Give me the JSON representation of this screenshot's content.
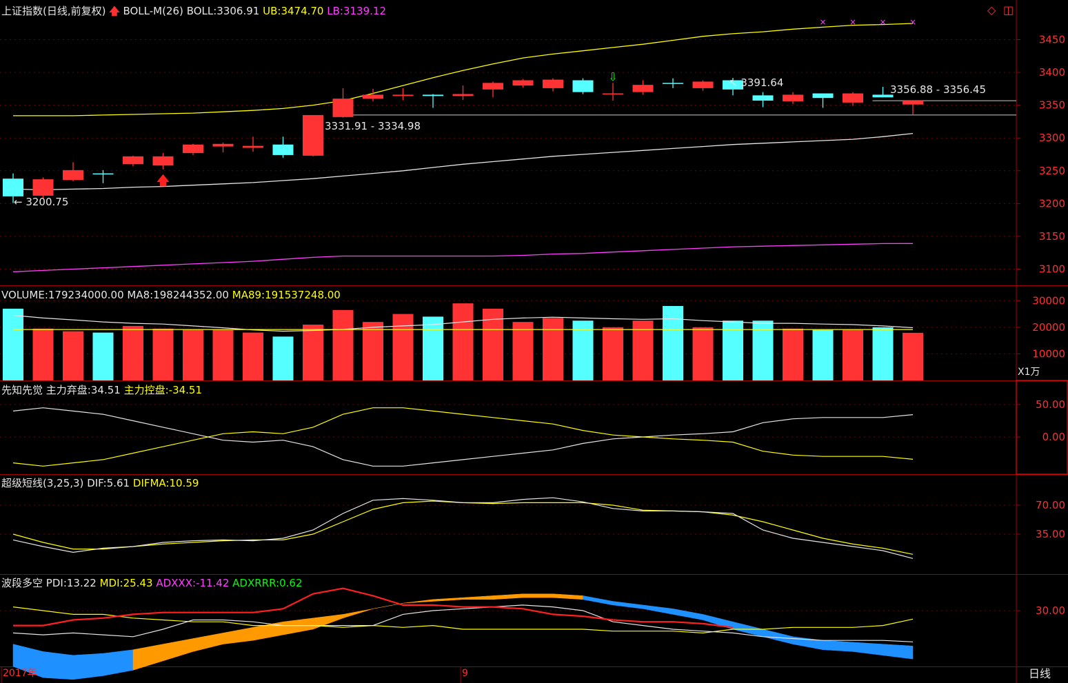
{
  "header": {
    "title": "上证指数(日线,前复权)",
    "boll_name": "BOLL-M(26)",
    "boll_label": "BOLL:",
    "boll_value": "3306.91",
    "ub_label": "UB:",
    "ub_value": "3474.70",
    "lb_label": "LB:",
    "lb_value": "3139.12"
  },
  "volume_header": {
    "name": "VOLUME:",
    "value": "179234000.00",
    "ma8_label": "MA8:",
    "ma8_value": "198244352.00",
    "ma89_label": "MA89:",
    "ma89_value": "191537248.00",
    "unit": "X1万"
  },
  "xzxj_header": {
    "name": "先知先觉",
    "a_label": "主力弃盘:",
    "a_value": "34.51",
    "b_label": "主力控盘:",
    "b_value": "-34.51"
  },
  "cjdx_header": {
    "name": "超级短线(3,25,3)",
    "dif_label": "DIF:",
    "dif_value": "5.61",
    "difma_label": "DIFMA:",
    "difma_value": "10.59"
  },
  "bddk_header": {
    "name": "波段多空",
    "pdi_label": "PDI:",
    "pdi_value": "13.22",
    "mdi_label": "MDI:",
    "mdi_value": "25.43",
    "adxxx_label": "ADXXX:",
    "adxxx_value": "-11.42",
    "adxrrr_label": "ADXRRR:",
    "adxrrr_value": "0.62"
  },
  "annotations": {
    "low_label": "3200.75",
    "high_label": "3391.64",
    "gap_low": "3331.91 - 3334.98",
    "gap_high": "3356.88 - 3356.45"
  },
  "time_axis": {
    "start": "2017年",
    "mid": "9",
    "period": "日线"
  },
  "colors": {
    "up": "#ff3333",
    "down": "#55ffff",
    "boll": "#e6e6e6",
    "ub": "#ffff00",
    "lb": "#ff40ff",
    "orange": "#ff9900",
    "blue": "#1e90ff"
  },
  "chart_data": {
    "type": "candlestick",
    "price_axis": {
      "ticks": [
        3100,
        3150,
        3200,
        3250,
        3300,
        3350,
        3400,
        3450
      ]
    },
    "candles": [
      {
        "o": 3211,
        "h": 3246,
        "l": 3200.75,
        "c": 3238,
        "up": false
      },
      {
        "o": 3212,
        "h": 3240,
        "l": 3208,
        "c": 3237,
        "up": true
      },
      {
        "o": 3236,
        "h": 3263,
        "l": 3234,
        "c": 3251,
        "up": true
      },
      {
        "o": 3246,
        "h": 3251,
        "l": 3231,
        "c": 3245,
        "up": false
      },
      {
        "o": 3260,
        "h": 3273,
        "l": 3257,
        "c": 3272,
        "up": true
      },
      {
        "o": 3258,
        "h": 3277,
        "l": 3252,
        "c": 3272,
        "up": true
      },
      {
        "o": 3277,
        "h": 3291,
        "l": 3274,
        "c": 3290,
        "up": true
      },
      {
        "o": 3287,
        "h": 3293,
        "l": 3278,
        "c": 3291,
        "up": true
      },
      {
        "o": 3285,
        "h": 3302,
        "l": 3279,
        "c": 3288,
        "up": true
      },
      {
        "o": 3290,
        "h": 3302,
        "l": 3270,
        "c": 3274,
        "up": false
      },
      {
        "o": 3273,
        "h": 3331,
        "l": 3272,
        "c": 3334.98,
        "up": true
      },
      {
        "o": 3331.91,
        "h": 3376,
        "l": 3331,
        "c": 3360,
        "up": true
      },
      {
        "o": 3360,
        "h": 3375,
        "l": 3356,
        "c": 3366,
        "up": true
      },
      {
        "o": 3364,
        "h": 3376,
        "l": 3358,
        "c": 3366,
        "up": true
      },
      {
        "o": 3366,
        "h": 3367,
        "l": 3346,
        "c": 3364,
        "up": false
      },
      {
        "o": 3364,
        "h": 3380,
        "l": 3358,
        "c": 3367,
        "up": true
      },
      {
        "o": 3374,
        "h": 3386,
        "l": 3362,
        "c": 3384,
        "up": true
      },
      {
        "o": 3380,
        "h": 3390,
        "l": 3377,
        "c": 3388,
        "up": true
      },
      {
        "o": 3376,
        "h": 3391,
        "l": 3371,
        "c": 3389,
        "up": true
      },
      {
        "o": 3388,
        "h": 3391,
        "l": 3367,
        "c": 3370,
        "up": false
      },
      {
        "o": 3368,
        "h": 3384,
        "l": 3357,
        "c": 3367,
        "up": true
      },
      {
        "o": 3370,
        "h": 3388,
        "l": 3366,
        "c": 3381,
        "up": true
      },
      {
        "o": 3384,
        "h": 3391,
        "l": 3376,
        "c": 3384,
        "up": false
      },
      {
        "o": 3376,
        "h": 3388,
        "l": 3372,
        "c": 3386,
        "up": true
      },
      {
        "o": 3374,
        "h": 3391.64,
        "l": 3365,
        "c": 3388,
        "up": false
      },
      {
        "o": 3365,
        "h": 3370,
        "l": 3347,
        "c": 3357,
        "up": false
      },
      {
        "o": 3356,
        "h": 3370,
        "l": 3352,
        "c": 3366,
        "up": true
      },
      {
        "o": 3361,
        "h": 3368,
        "l": 3346,
        "c": 3368,
        "up": false
      },
      {
        "o": 3354,
        "h": 3370,
        "l": 3349,
        "c": 3368,
        "up": true
      },
      {
        "o": 3362,
        "h": 3378,
        "l": 3362,
        "c": 3366,
        "up": false
      },
      {
        "o": 3351,
        "h": 3356,
        "l": 3336,
        "c": 3356.88,
        "up": true
      }
    ],
    "boll": [
      3222,
      3221,
      3222,
      3223,
      3225,
      3226,
      3228,
      3230,
      3232,
      3235,
      3238,
      3242,
      3246,
      3250,
      3255,
      3260,
      3264,
      3268,
      3272,
      3275,
      3278,
      3281,
      3284,
      3287,
      3290,
      3292,
      3294,
      3296,
      3298,
      3302,
      3306.91
    ],
    "ub": [
      3334,
      3334,
      3334,
      3335,
      3336,
      3337,
      3338,
      3340,
      3342,
      3345,
      3350,
      3357,
      3368,
      3380,
      3392,
      3403,
      3413,
      3422,
      3428,
      3433,
      3438,
      3443,
      3449,
      3455,
      3459,
      3462,
      3466,
      3469,
      3472,
      3473,
      3474.7
    ],
    "lb": [
      3096,
      3098,
      3100,
      3102,
      3104,
      3106,
      3108,
      3110,
      3112,
      3115,
      3118,
      3120,
      3120,
      3120,
      3120,
      3120,
      3120,
      3121,
      3123,
      3124,
      3126,
      3128,
      3130,
      3132,
      3134,
      3135,
      3136,
      3137,
      3138,
      3139,
      3139.12
    ],
    "volume": [
      27000,
      19500,
      18500,
      18000,
      20500,
      19500,
      19000,
      19000,
      18000,
      16500,
      21000,
      26500,
      22000,
      25000,
      24000,
      29000,
      27000,
      22000,
      23500,
      22500,
      20000,
      22500,
      28000,
      20000,
      22500,
      22500,
      19500,
      19000,
      19000,
      20000,
      17923
    ],
    "vol_ma8": [
      24500,
      23500,
      22800,
      22000,
      21500,
      21200,
      20500,
      19800,
      19000,
      18500,
      18800,
      19200,
      20000,
      20500,
      21000,
      22000,
      23000,
      23500,
      23800,
      23500,
      23200,
      23000,
      23200,
      22500,
      22000,
      21500,
      21500,
      21200,
      21000,
      20500,
      19824
    ],
    "vol_ma89": 19154,
    "xzxj": {
      "qipan": [
        40,
        45,
        40,
        35,
        25,
        15,
        5,
        -5,
        -8,
        -5,
        -15,
        -35,
        -45,
        -45,
        -40,
        -35,
        -30,
        -25,
        -20,
        -10,
        -3,
        0,
        3,
        5,
        8,
        22,
        28,
        30,
        30,
        30,
        34.51
      ],
      "kongpan": [
        -40,
        -45,
        -40,
        -35,
        -25,
        -15,
        -5,
        5,
        8,
        5,
        15,
        35,
        45,
        45,
        40,
        35,
        30,
        25,
        20,
        10,
        3,
        0,
        -3,
        -5,
        -8,
        -22,
        -28,
        -30,
        -30,
        -30,
        -34.51
      ]
    },
    "cjdx": {
      "dif": [
        28,
        20,
        13,
        18,
        20,
        25,
        27,
        28,
        27,
        30,
        40,
        60,
        76,
        78,
        76,
        73,
        73,
        77,
        79,
        74,
        66,
        63,
        63,
        62,
        60,
        40,
        30,
        25,
        20,
        15,
        5.61
      ],
      "difma": [
        35,
        25,
        17,
        17,
        20,
        23,
        25,
        27,
        28,
        28,
        35,
        50,
        65,
        73,
        75,
        73,
        72,
        73,
        73,
        73,
        70,
        64,
        63,
        62,
        58,
        50,
        40,
        30,
        23,
        18,
        10.59
      ]
    },
    "bddk": {
      "pdi": [
        18,
        17,
        18,
        17,
        16,
        20,
        25,
        25,
        24,
        22,
        22,
        22,
        22,
        28,
        30,
        31,
        32,
        33,
        32,
        30,
        24,
        22,
        20,
        19,
        18,
        16,
        15,
        14,
        14,
        14,
        13.22
      ],
      "mdi": [
        32,
        30,
        28,
        28,
        26,
        25,
        24,
        24,
        22,
        22,
        22,
        21,
        22,
        21,
        22,
        20,
        20,
        20,
        20,
        20,
        19,
        19,
        19,
        18,
        20,
        20,
        21,
        21,
        21,
        22,
        25.43
      ],
      "red": [
        22,
        22,
        25,
        26,
        28,
        29,
        29,
        29,
        29,
        31,
        39,
        42,
        38,
        33,
        33,
        32,
        32,
        31,
        28,
        27,
        25,
        24,
        24,
        23,
        21
      ],
      "band_top": [
        12,
        8,
        6,
        7,
        9,
        12,
        15,
        18,
        21,
        24,
        26,
        28,
        31,
        34,
        36,
        37,
        38,
        39,
        39,
        38,
        35,
        33,
        31,
        28,
        24,
        20,
        16,
        14,
        13,
        12,
        11
      ],
      "band_bot": [
        0,
        -6,
        -7,
        -5,
        -2,
        3,
        8,
        12,
        14,
        17,
        20,
        26,
        31,
        34,
        35,
        36,
        36,
        37,
        37,
        36,
        33,
        31,
        28,
        25,
        20,
        16,
        12,
        9,
        8,
        6,
        4
      ]
    }
  }
}
